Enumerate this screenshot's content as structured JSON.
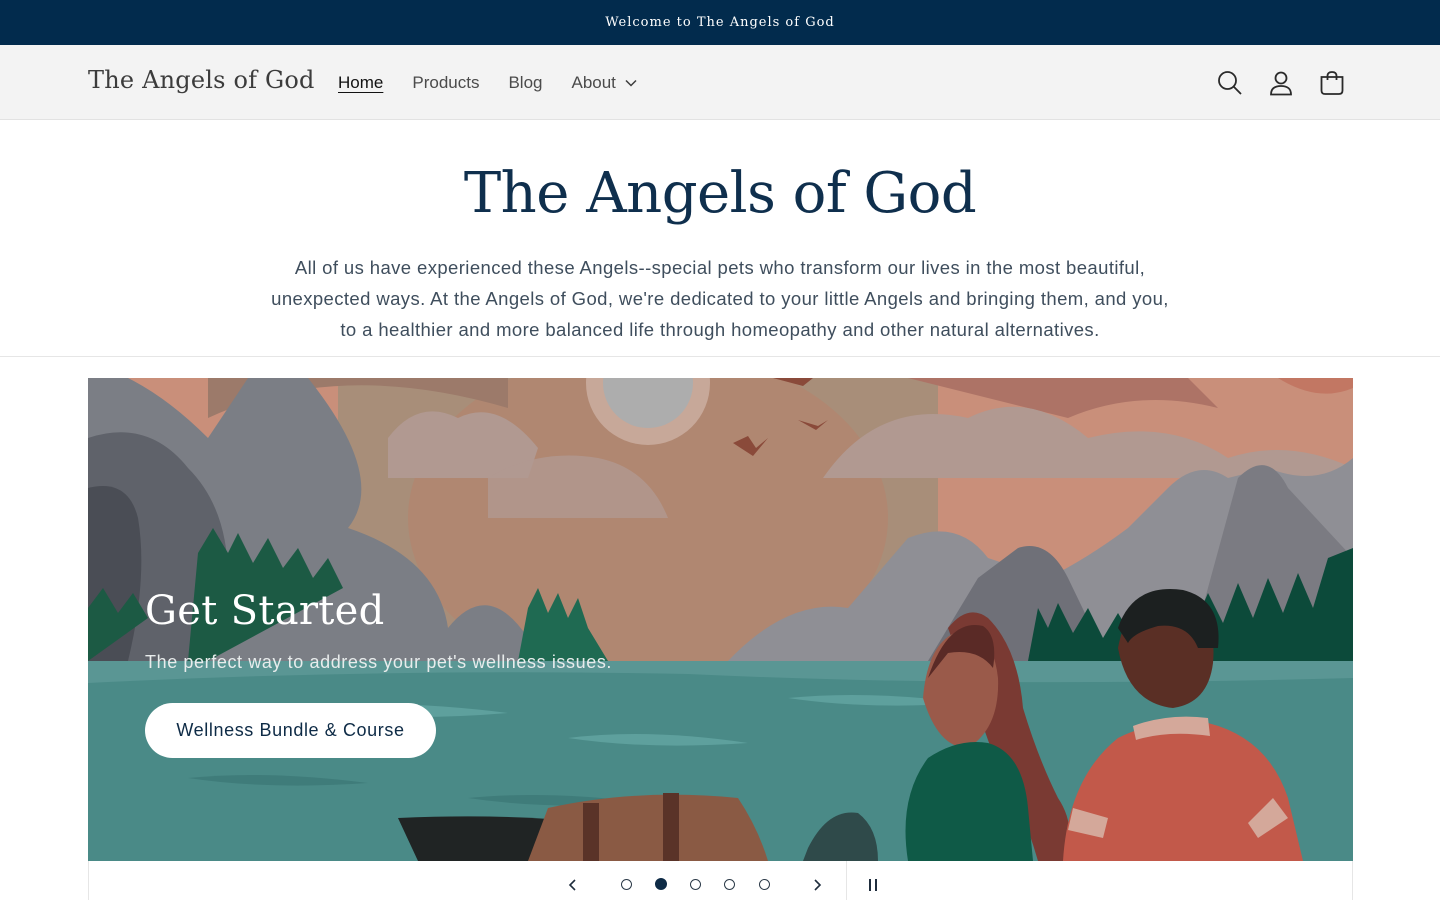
{
  "announcement": "Welcome to The Angels of God",
  "header": {
    "logo": "The Angels of God",
    "nav": [
      {
        "label": "Home",
        "active": true
      },
      {
        "label": "Products"
      },
      {
        "label": "Blog"
      },
      {
        "label": "About",
        "dropdown": true
      }
    ],
    "icons": [
      "search-icon",
      "account-icon",
      "cart-icon"
    ]
  },
  "intro": {
    "title": "The Angels of God",
    "text": "All of us have experienced these Angels--special pets who transform our lives in the most beautiful, unexpected ways. At the Angels of God, we're dedicated to your little Angels and bringing them, and you, to a healthier and more balanced life through homeopathy and other natural alternatives."
  },
  "slideshow": {
    "title": "Get Started",
    "subtitle": "The perfect way to address your pet's wellness issues.",
    "button": "Wellness Bundle & Course",
    "slide_count": 5,
    "active_slide": 2,
    "controls": [
      "chevron-left-icon",
      "chevron-right-icon",
      "pause-icon"
    ]
  },
  "colors": {
    "announcement_bg": "#022b4d",
    "header_bg": "#f3f3f3",
    "heading": "#0f2f4d",
    "accent": "#0e2b46"
  }
}
